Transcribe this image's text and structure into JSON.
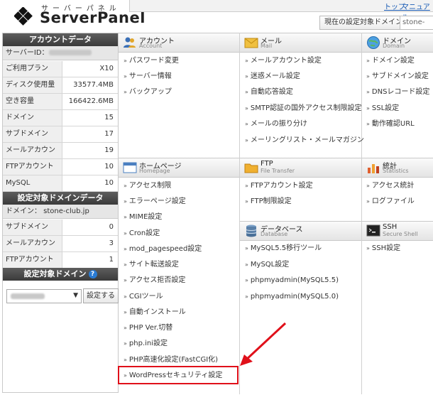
{
  "header": {
    "logo_kana": "サーバーパネル",
    "logo_text": "ServerPanel",
    "top_links": [
      "トップ",
      "マニュアル"
    ],
    "current_domain_button": "現在の設定対象ドメイン",
    "domain_select_value": "stone-club"
  },
  "sidebar": {
    "account_title": "アカウントデータ",
    "server_id_label": "サーバーID：",
    "account_rows": [
      {
        "label": "ご利用プラン",
        "value": "X10"
      },
      {
        "label": "ディスク使用量",
        "value": "33577.4MB"
      },
      {
        "label": "空き容量",
        "value": "166422.6MB"
      },
      {
        "label": "ドメイン",
        "value": "15"
      },
      {
        "label": "サブドメイン",
        "value": "17"
      },
      {
        "label": "メールアカウント",
        "value": "19"
      },
      {
        "label": "FTPアカウント",
        "value": "10"
      },
      {
        "label": "MySQL",
        "value": "10"
      }
    ],
    "domain_data_title": "設定対象ドメインデータ",
    "domain_label": "ドメイン： stone-club.jp",
    "domain_rows": [
      {
        "label": "サブドメイン",
        "value": "0"
      },
      {
        "label": "メールアカウント",
        "value": "3"
      },
      {
        "label": "FTPアカウント",
        "value": "1"
      }
    ],
    "target_domain_title": "設定対象ドメイン",
    "set_button": "設定する"
  },
  "categories": {
    "account": {
      "title": "アカウント",
      "sub": "Account",
      "items": [
        "パスワード変更",
        "サーバー情報",
        "バックアップ"
      ]
    },
    "mail": {
      "title": "メール",
      "sub": "Mail",
      "items": [
        "メールアカウント設定",
        "迷惑メール設定",
        "自動応答設定",
        "SMTP認証の国外アクセス制限設定",
        "メールの振り分け",
        "メーリングリスト・メールマガジン"
      ]
    },
    "domain": {
      "title": "ドメイン",
      "sub": "Domain",
      "items": [
        "ドメイン設定",
        "サブドメイン設定",
        "DNSレコード設定",
        "SSL設定",
        "動作確認URL"
      ]
    },
    "homepage": {
      "title": "ホームページ",
      "sub": "Homepage",
      "items": [
        "アクセス制限",
        "エラーページ設定",
        "MIME設定",
        "Cron設定",
        "mod_pagespeed設定",
        "サイト転送設定",
        "アクセス拒否設定",
        "CGIツール",
        "自動インストール",
        "PHP Ver.切替",
        "php.ini設定",
        "PHP高速化設定(FastCGI化)",
        "WordPressセキュリティ設定"
      ]
    },
    "ftp": {
      "title": "FTP",
      "sub": "File Transfer",
      "items": [
        "FTPアカウント設定",
        "FTP制限設定"
      ]
    },
    "stats": {
      "title": "統計",
      "sub": "Statistics",
      "items": [
        "アクセス統計",
        "ログファイル"
      ]
    },
    "database": {
      "title": "データベース",
      "sub": "Database",
      "items": [
        "MySQL5.5移行ツール",
        "MySQL設定",
        "phpmyadmin(MySQL5.5)",
        "phpmyadmin(MySQL5.0)"
      ]
    },
    "ssh": {
      "title": "SSH",
      "sub": "Secure Shell",
      "items": [
        "SSH設定"
      ]
    }
  }
}
